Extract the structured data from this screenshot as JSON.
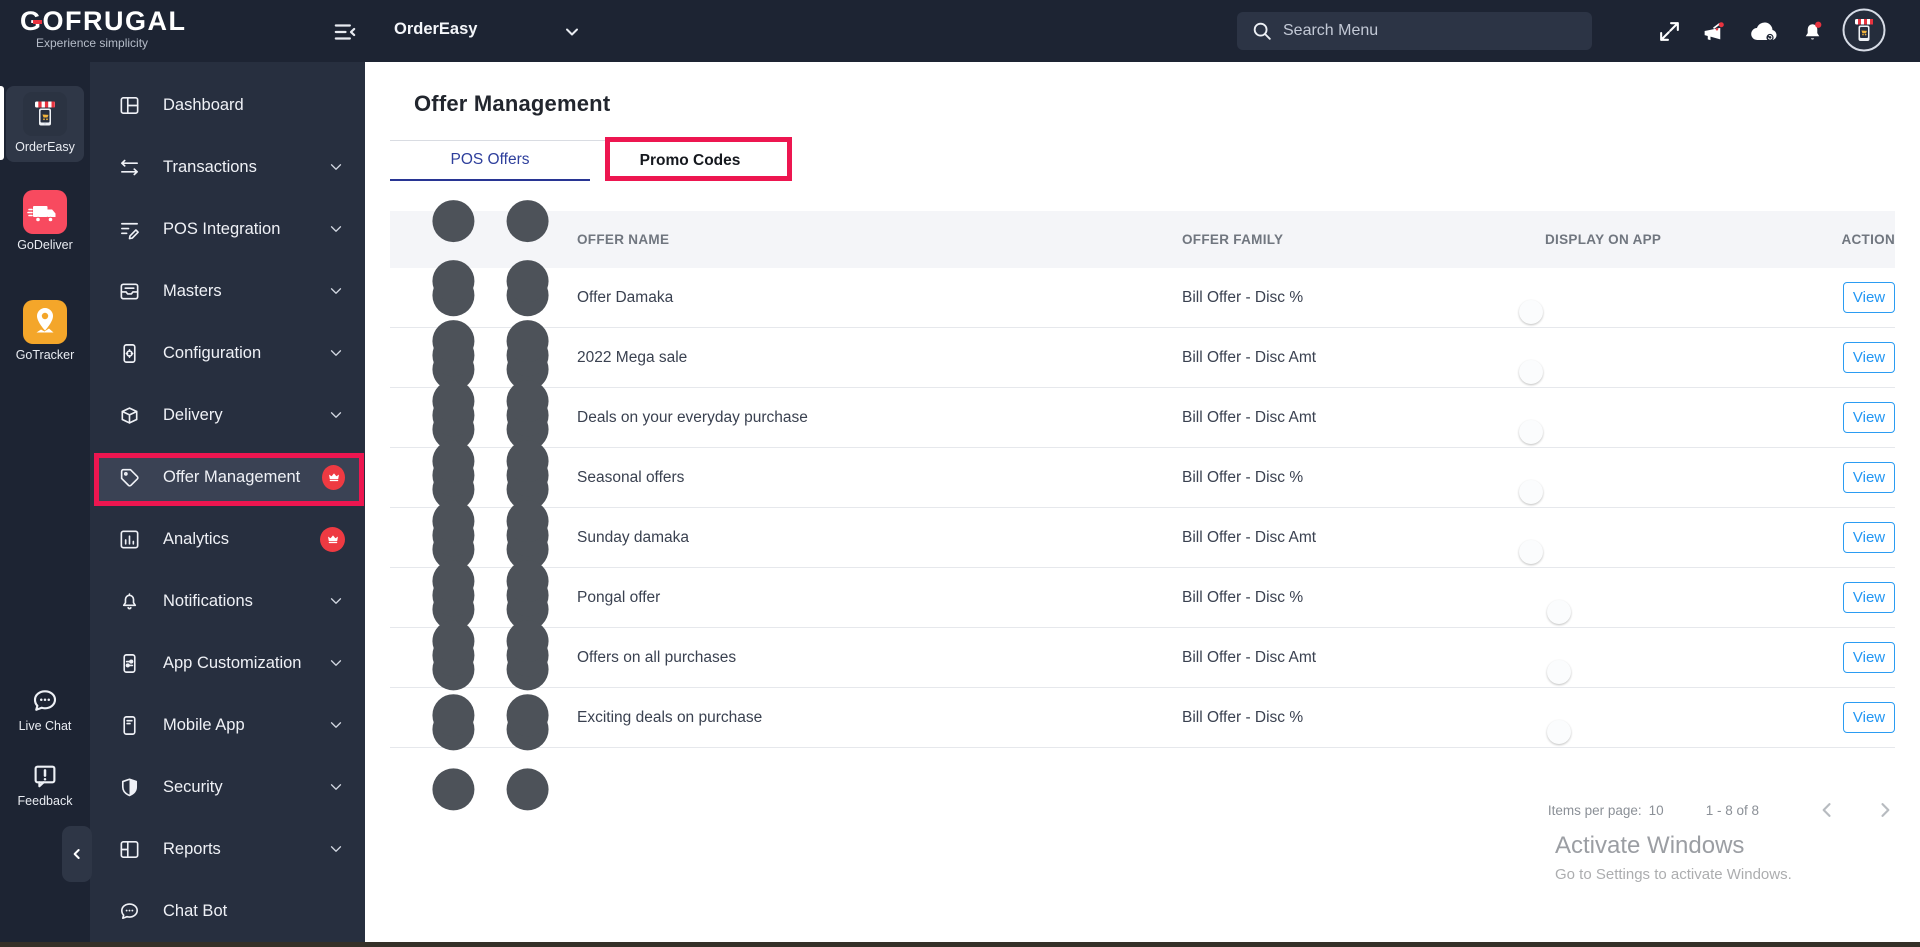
{
  "header": {
    "logo": {
      "title": "GOFRUGAL",
      "tagline": "Experience simplicity"
    },
    "product_switcher": {
      "label": "OrderEasy"
    },
    "search": {
      "placeholder": "Search Menu"
    },
    "icons": [
      "menu-collapse",
      "fullscreen",
      "announcements",
      "cloud-sync",
      "notifications",
      "store-avatar"
    ]
  },
  "rail": {
    "apps": [
      {
        "label": "OrderEasy",
        "icon": "ordereasy-app",
        "active": true
      },
      {
        "label": "GoDeliver",
        "icon": "godeliver-app",
        "active": false
      },
      {
        "label": "GoTracker",
        "icon": "gotracker-app",
        "active": false
      }
    ],
    "bottom": [
      {
        "label": "Live Chat",
        "icon": "live-chat"
      },
      {
        "label": "Feedback",
        "icon": "feedback"
      }
    ]
  },
  "sidebar": {
    "items": [
      {
        "label": "Dashboard",
        "icon": "dashboard",
        "chevron": false,
        "badge": false,
        "selected": false
      },
      {
        "label": "Transactions",
        "icon": "transactions",
        "chevron": true,
        "badge": false,
        "selected": false
      },
      {
        "label": "POS Integration",
        "icon": "pos-integration",
        "chevron": true,
        "badge": false,
        "selected": false
      },
      {
        "label": "Masters",
        "icon": "masters",
        "chevron": true,
        "badge": false,
        "selected": false
      },
      {
        "label": "Configuration",
        "icon": "configuration",
        "chevron": true,
        "badge": false,
        "selected": false
      },
      {
        "label": "Delivery",
        "icon": "delivery",
        "chevron": true,
        "badge": false,
        "selected": false
      },
      {
        "label": "Offer Management",
        "icon": "offer-management",
        "chevron": false,
        "badge": true,
        "selected": true
      },
      {
        "label": "Analytics",
        "icon": "analytics",
        "chevron": false,
        "badge": true,
        "selected": false
      },
      {
        "label": "Notifications",
        "icon": "notifications",
        "chevron": true,
        "badge": false,
        "selected": false
      },
      {
        "label": "App Customization",
        "icon": "app-customization",
        "chevron": true,
        "badge": false,
        "selected": false
      },
      {
        "label": "Mobile App",
        "icon": "mobile-app",
        "chevron": true,
        "badge": false,
        "selected": false
      },
      {
        "label": "Security",
        "icon": "security",
        "chevron": true,
        "badge": false,
        "selected": false
      },
      {
        "label": "Reports",
        "icon": "reports",
        "chevron": true,
        "badge": false,
        "selected": false
      },
      {
        "label": "Chat Bot",
        "icon": "chat-bot",
        "chevron": false,
        "badge": false,
        "selected": false
      }
    ]
  },
  "main": {
    "title": "Offer Management",
    "tabs": [
      {
        "label": "POS Offers",
        "active": true,
        "annotated": false
      },
      {
        "label": "Promo Codes",
        "active": false,
        "annotated": true
      }
    ],
    "table": {
      "columns": [
        "OFFER NAME",
        "OFFER FAMILY",
        "DISPLAY ON APP",
        "ACTION"
      ],
      "rows": [
        {
          "name": "Offer Damaka",
          "family": "Bill Offer - Disc %",
          "display_on_app": true,
          "action": "View"
        },
        {
          "name": "2022 Mega sale",
          "family": "Bill Offer - Disc Amt",
          "display_on_app": true,
          "action": "View"
        },
        {
          "name": "Deals on your everyday purchase",
          "family": "Bill Offer - Disc Amt",
          "display_on_app": true,
          "action": "View"
        },
        {
          "name": "Seasonal offers",
          "family": "Bill Offer - Disc %",
          "display_on_app": true,
          "action": "View"
        },
        {
          "name": "Sunday damaka",
          "family": "Bill Offer - Disc Amt",
          "display_on_app": true,
          "action": "View"
        },
        {
          "name": "Pongal offer",
          "family": "Bill Offer - Disc %",
          "display_on_app": false,
          "action": "View"
        },
        {
          "name": "Offers on all purchases",
          "family": "Bill Offer - Disc Amt",
          "display_on_app": false,
          "action": "View"
        },
        {
          "name": "Exciting deals on purchase",
          "family": "Bill Offer - Disc %",
          "display_on_app": false,
          "action": "View"
        }
      ]
    },
    "pagination": {
      "items_per_page_label": "Items per page:",
      "items_per_page": "10",
      "range": "1 - 8 of 8"
    }
  },
  "watermark": {
    "line1": "Activate Windows",
    "line2": "Go to Settings to activate Windows."
  },
  "colors": {
    "header_bg": "#1d2433",
    "sidebar_bg": "#272f3f",
    "selected_item_bg": "#3a4254",
    "annotation_red": "#ed1650",
    "badge_red": "#ee3a42",
    "toggle_on_green": "#81d788",
    "toggle_off_gray": "#9aa0a6",
    "view_button_blue": "#2196f3",
    "tab_active_blue": "#2e3f9c"
  }
}
